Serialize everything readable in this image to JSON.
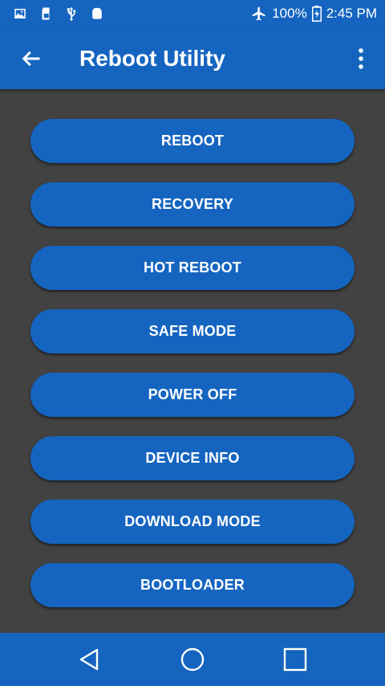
{
  "status_bar": {
    "icons": [
      "image-icon",
      "sd-card-icon",
      "usb-icon",
      "android-icon"
    ],
    "airplane_icon": "airplane-icon",
    "battery_percent": "100%",
    "battery_icon": "battery-charging-icon",
    "time": "2:45 PM"
  },
  "app_bar": {
    "title": "Reboot Utility",
    "back_icon": "arrow-back-icon",
    "menu_icon": "more-vert-icon"
  },
  "buttons": [
    {
      "label": "REBOOT"
    },
    {
      "label": "RECOVERY"
    },
    {
      "label": "HOT REBOOT"
    },
    {
      "label": "SAFE MODE"
    },
    {
      "label": "POWER OFF"
    },
    {
      "label": "DEVICE INFO"
    },
    {
      "label": "DOWNLOAD MODE"
    },
    {
      "label": "BOOTLOADER"
    }
  ],
  "nav_bar": {
    "back": "nav-back-icon",
    "home": "nav-home-icon",
    "recents": "nav-recents-icon"
  },
  "colors": {
    "primary": "#1565c0",
    "background": "#424242",
    "text": "#ffffff"
  }
}
